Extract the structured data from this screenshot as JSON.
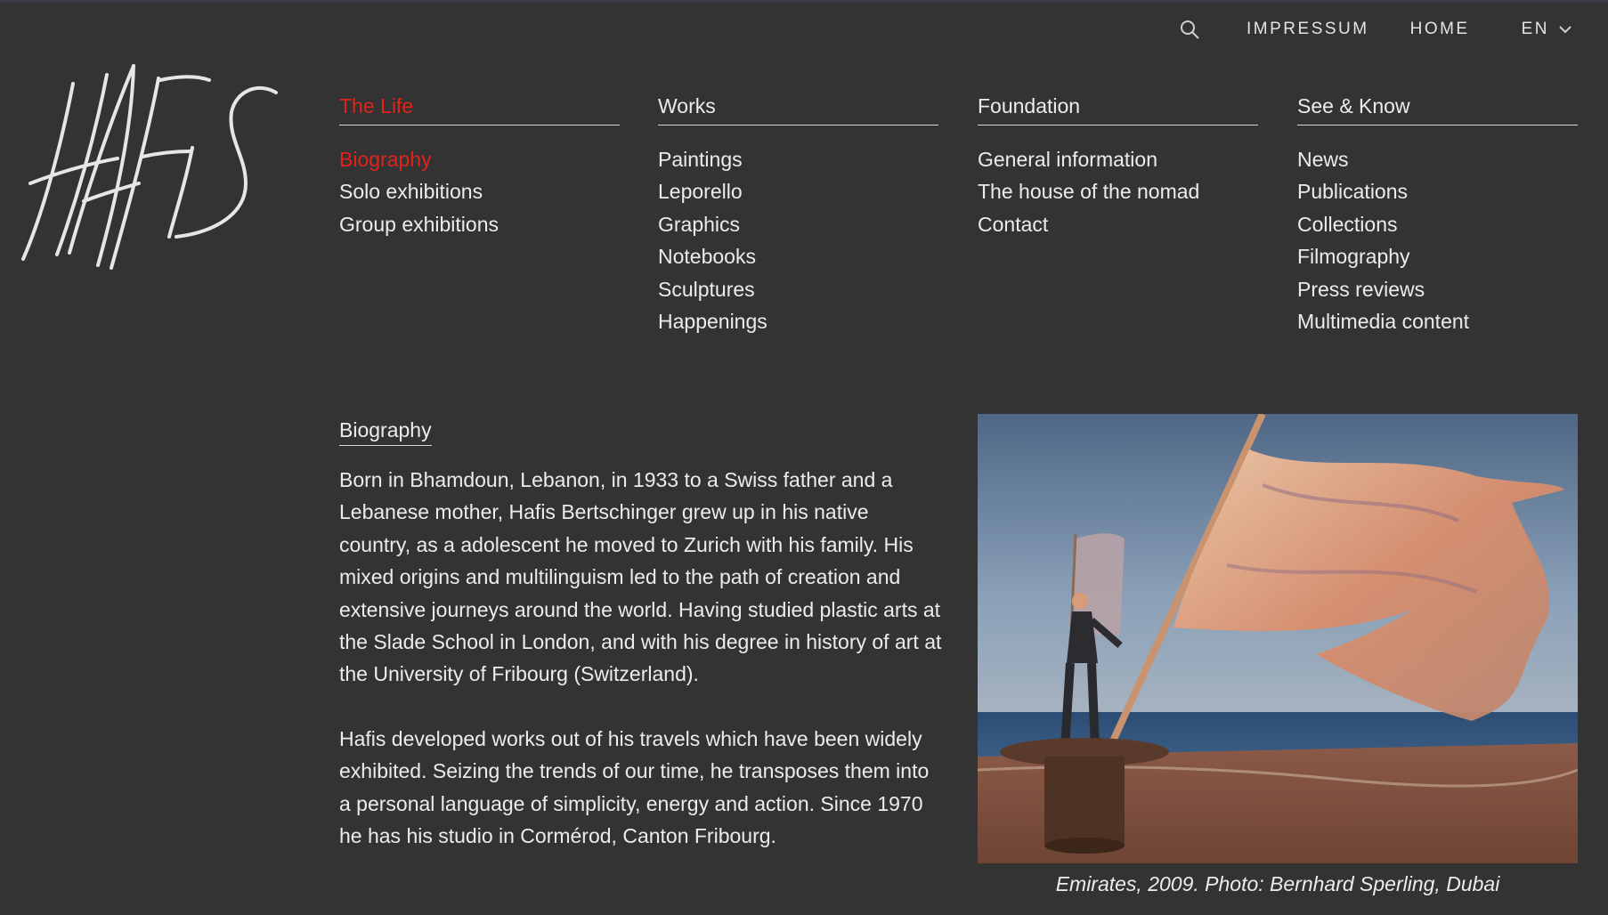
{
  "topbar": {
    "search_icon": "search-icon",
    "links": [
      "IMPRESSUM",
      "HOME"
    ],
    "language": "EN"
  },
  "logo_text": "HAFIS",
  "menu": [
    {
      "heading": "The Life",
      "active": true,
      "items": [
        "Biography",
        "Solo exhibitions",
        "Group exhibitions"
      ],
      "active_item": 0
    },
    {
      "heading": "Works",
      "active": false,
      "items": [
        "Paintings",
        "Leporello",
        "Graphics",
        "Notebooks",
        "Sculptures",
        "Happenings"
      ],
      "active_item": -1
    },
    {
      "heading": "Foundation",
      "active": false,
      "items": [
        "General information",
        "The house of the nomad",
        "Contact"
      ],
      "active_item": -1
    },
    {
      "heading": "See & Know",
      "active": false,
      "items": [
        "News",
        "Publications",
        "Collections",
        "Filmography",
        "Press reviews",
        "Multimedia content"
      ],
      "active_item": -1
    }
  ],
  "content": {
    "title": "Biography",
    "paragraphs": [
      "Born in Bhamdoun, Lebanon, in 1933 to a Swiss father and a Lebanese mother, Hafis Bertschinger grew up in his native country, as a adolescent he moved to Zurich with his family. His mixed origins and multilinguism led to the path of creation and extensive journeys around the world. Having studied plastic arts at the Slade School in London, and with his degree in history of art at the University of Fribourg (Switzerland).",
      "Hafis developed works out of his travels which have been widely exhibited. Seizing the trends of our time, he transposes them into a personal language of simplicity, energy and action. Since 1970 he has his studio in Cormérod, Canton Fribourg."
    ]
  },
  "image": {
    "caption": "Emirates, 2009. Photo: Bernhard Sperling, Dubai"
  },
  "colors": {
    "background": "#333333",
    "text": "#ececec",
    "accent": "#e2231a"
  }
}
